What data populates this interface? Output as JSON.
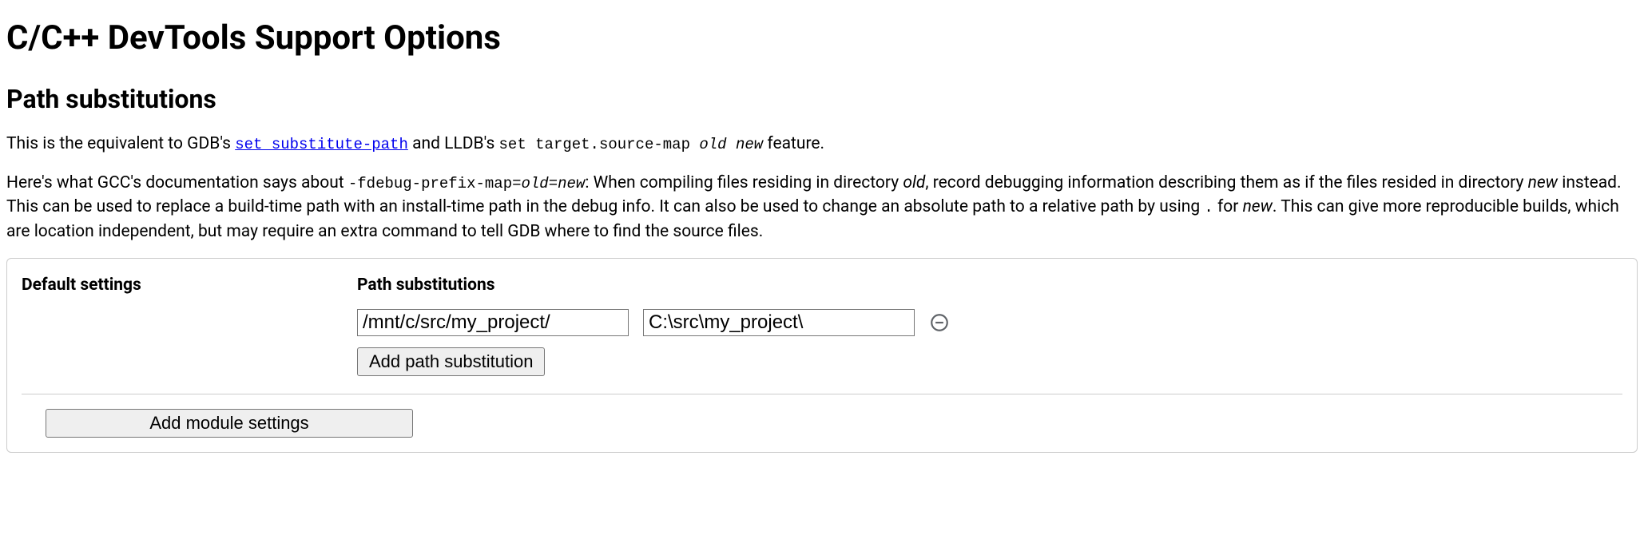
{
  "page": {
    "title": "C/C++ DevTools Support Options",
    "section_heading": "Path substitutions"
  },
  "para1": {
    "pre_link": "This is the equivalent to GDB's ",
    "link_text": "set substitute-path",
    "mid": " and LLDB's ",
    "code2_a": "set target.source-map ",
    "code2_b": "old new",
    "post": " feature."
  },
  "para2": {
    "a": "Here's what GCC's documentation says about ",
    "flag": "-fdebug-prefix-map=",
    "oldnew": "old=new",
    "b": ": When compiling files residing in directory ",
    "old": "old",
    "c": ", record debugging information describing them as if the files resided in directory ",
    "new": "new",
    "d": " instead. This can be used to replace a build-time path with an install-time path in the debug info. It can also be used to change an absolute path to a relative path by using ",
    "dot": ".",
    "e": " for ",
    "new2": "new",
    "f": ". This can give more reproducible builds, which are location independent, but may require an extra command to tell GDB where to find the source files."
  },
  "panel": {
    "default_label": "Default settings",
    "subs_label": "Path substitutions",
    "from_value": "/mnt/c/src/my_project/",
    "to_value": "C:\\src\\my_project\\",
    "add_sub_label": "Add path substitution",
    "add_module_label": "Add module settings"
  }
}
